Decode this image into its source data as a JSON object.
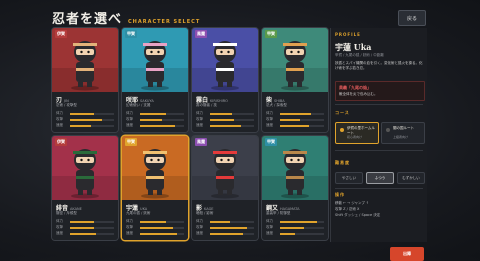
{
  "header": {
    "title": "忍者を選べ",
    "subtitle": "CHARACTER SELECT",
    "back_label": "戻る"
  },
  "characters": [
    {
      "name": "刃",
      "en": "JIN",
      "role": "忍術 / 攻撃型",
      "badge": "伊賀",
      "badge_color": "#b43c3c",
      "bg": "#9c3434",
      "accent": "#e3b27a",
      "stats": [
        0.55,
        0.72,
        0.48
      ],
      "stat_labels": [
        "体力",
        "攻撃",
        "速度"
      ]
    },
    {
      "name": "咲耶",
      "en": "SAKUYA",
      "role": "幻術使い / 支援",
      "badge": "甲賀",
      "badge_color": "#2e8fa5",
      "bg": "#2f9ab3",
      "accent": "#e9a3c5",
      "stats": [
        0.6,
        0.5,
        0.8
      ],
      "stat_labels": [
        "体力",
        "攻撃",
        "速度"
      ]
    },
    {
      "name": "霧白",
      "en": "KIRISHIRO",
      "role": "霧の隠者 / 技",
      "badge": "風魔",
      "badge_color": "#8c4fb0",
      "bg": "#4a4fa6",
      "accent": "#ffffff",
      "stats": [
        0.5,
        0.55,
        0.7
      ],
      "stat_labels": [
        "体力",
        "攻撃",
        "速度"
      ]
    },
    {
      "name": "柴",
      "en": "SHIBA",
      "role": "忍犬 / 探索型",
      "badge": "甲賀",
      "badge_color": "#5a9a4a",
      "bg": "#3e8a7a",
      "accent": "#e0a050",
      "stats": [
        0.7,
        0.45,
        0.65
      ],
      "stat_labels": [
        "体力",
        "攻撃",
        "速度"
      ]
    },
    {
      "name": "緋音",
      "en": "AKANE",
      "role": "隠密 / 斥候型",
      "badge": "伊賀",
      "badge_color": "#b43c3c",
      "bg": "#a3314a",
      "accent": "#2a6a3a",
      "stats": [
        0.55,
        0.55,
        0.6
      ],
      "stat_labels": [
        "体力",
        "攻撃",
        "速度"
      ]
    },
    {
      "name": "宇蓮",
      "en": "UKA",
      "role": "九尾の狐 / 妖術",
      "badge": "甲賀",
      "badge_color": "#e0a32c",
      "bg": "#c96a23",
      "accent": "#f0c070",
      "stats": [
        0.6,
        0.75,
        0.85
      ],
      "stat_labels": [
        "体力",
        "攻撃",
        "速度"
      ]
    },
    {
      "name": "影",
      "en": "KAGE",
      "role": "暗殺 / 影術",
      "badge": "風魔",
      "badge_color": "#8c4fb0",
      "bg": "#3c3f4a",
      "accent": "#e33a3a",
      "stats": [
        0.45,
        0.85,
        0.75
      ],
      "stat_labels": [
        "体力",
        "攻撃",
        "速度"
      ]
    },
    {
      "name": "鋼又",
      "en": "HAGAMATA",
      "role": "重装甲 / 防御型",
      "badge": "甲賀",
      "badge_color": "#2e8fa5",
      "bg": "#2f7f73",
      "accent": "#b9874a",
      "stats": [
        0.85,
        0.55,
        0.35
      ],
      "stat_labels": [
        "体力",
        "攻撃",
        "速度"
      ]
    }
  ],
  "panel": {
    "profile_tag": "PROFILE",
    "name": "宇蓮 Uka",
    "meta": "甲賀 / 九尾の狐 / 妖術 / 中距離",
    "desc": "妖狐とスパイ機関の血を引く。変化術と狐火を操る。化け術を学ぶ若き忍。",
    "skill_name": "奥義「九尾の焔」",
    "skill_desc": "敵全体を炎で包み込む。",
    "course_tag": "コース",
    "courses": [
      {
        "title": "伊賀の里ホームルート",
        "sub": "初心者向け",
        "selected": true
      },
      {
        "title": "闇の国ルート",
        "sub": "上級者向け",
        "selected": false
      }
    ],
    "difficulty_tag": "難易度",
    "difficulties": [
      {
        "label": "やさしい",
        "selected": false
      },
      {
        "label": "ふつう",
        "selected": true
      },
      {
        "label": "むずかしい",
        "selected": false
      }
    ],
    "ops_tag": "操作",
    "ops": [
      "移動 ← → ジャンプ ↑",
      "攻撃 Z / 忍術 X",
      "Shift ダッシュ / Space 決定"
    ],
    "start_label": "出陣"
  }
}
